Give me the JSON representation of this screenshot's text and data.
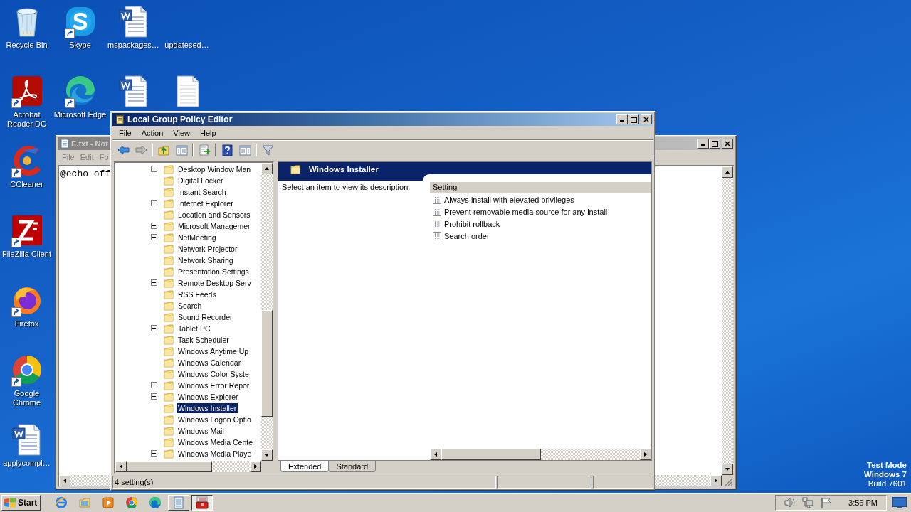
{
  "desktop": {
    "columns": [
      [
        {
          "label": "Recycle Bin",
          "kind": "recycle",
          "shortcut": false
        },
        {
          "label": "Acrobat Reader DC",
          "kind": "acrobat",
          "shortcut": true
        },
        {
          "label": "CCleaner",
          "kind": "ccleaner",
          "shortcut": true
        },
        {
          "label": "FileZilla Client",
          "kind": "filezilla",
          "shortcut": true
        },
        {
          "label": "Firefox",
          "kind": "firefox",
          "shortcut": true
        },
        {
          "label": "Google Chrome",
          "kind": "chrome",
          "shortcut": true
        },
        {
          "label": "applycompl…",
          "kind": "word",
          "shortcut": false
        }
      ],
      [
        {
          "label": "Skype",
          "kind": "skype",
          "shortcut": true
        },
        {
          "label": "Microsoft Edge",
          "kind": "edge",
          "shortcut": true
        }
      ],
      [
        {
          "label": "mspackages…",
          "kind": "word",
          "shortcut": false
        },
        {
          "kind": "word",
          "shortcut": false
        }
      ],
      [
        {
          "label": "updatesed…",
          "kind": "empty",
          "shortcut": false
        },
        {
          "kind": "text",
          "shortcut": false
        }
      ]
    ],
    "edition": [
      "Test Mode",
      "Windows 7",
      "Build 7601"
    ]
  },
  "notepad": {
    "title": "E.txt - Not",
    "menu": [
      "File",
      "Edit",
      "Fo"
    ],
    "text": "@echo off"
  },
  "gpedit": {
    "title": "Local Group Policy Editor",
    "menu": [
      "File",
      "Action",
      "View",
      "Help"
    ],
    "toolbar": [
      {
        "kind": "back"
      },
      {
        "kind": "forward"
      },
      {
        "kind": "separator"
      },
      {
        "kind": "up"
      },
      {
        "kind": "tree"
      },
      {
        "kind": "separator"
      },
      {
        "kind": "export"
      },
      {
        "kind": "separator"
      },
      {
        "kind": "help"
      },
      {
        "kind": "view"
      },
      {
        "kind": "separator"
      },
      {
        "kind": "filter"
      }
    ],
    "tree": [
      {
        "label": "Desktop Window Man",
        "expandable": true,
        "selected": false
      },
      {
        "label": "Digital Locker",
        "expandable": false,
        "selected": false
      },
      {
        "label": "Instant Search",
        "expandable": false,
        "selected": false
      },
      {
        "label": "Internet Explorer",
        "expandable": true,
        "selected": false
      },
      {
        "label": "Location and Sensors",
        "expandable": false,
        "selected": false
      },
      {
        "label": "Microsoft Managemer",
        "expandable": true,
        "selected": false
      },
      {
        "label": "NetMeeting",
        "expandable": true,
        "selected": false
      },
      {
        "label": "Network Projector",
        "expandable": false,
        "selected": false
      },
      {
        "label": "Network Sharing",
        "expandable": false,
        "selected": false
      },
      {
        "label": "Presentation Settings",
        "expandable": false,
        "selected": false
      },
      {
        "label": "Remote Desktop Serv",
        "expandable": true,
        "selected": false
      },
      {
        "label": "RSS Feeds",
        "expandable": false,
        "selected": false
      },
      {
        "label": "Search",
        "expandable": false,
        "selected": false
      },
      {
        "label": "Sound Recorder",
        "expandable": false,
        "selected": false
      },
      {
        "label": "Tablet PC",
        "expandable": true,
        "selected": false
      },
      {
        "label": "Task Scheduler",
        "expandable": false,
        "selected": false
      },
      {
        "label": "Windows Anytime Up",
        "expandable": false,
        "selected": false
      },
      {
        "label": "Windows Calendar",
        "expandable": false,
        "selected": false
      },
      {
        "label": "Windows Color Syste",
        "expandable": false,
        "selected": false
      },
      {
        "label": "Windows Error Repor",
        "expandable": true,
        "selected": false
      },
      {
        "label": "Windows Explorer",
        "expandable": true,
        "selected": false
      },
      {
        "label": "Windows Installer",
        "expandable": false,
        "selected": true
      },
      {
        "label": "Windows Logon Optio",
        "expandable": false,
        "selected": false
      },
      {
        "label": "Windows Mail",
        "expandable": false,
        "selected": false
      },
      {
        "label": "Windows Media Cente",
        "expandable": false,
        "selected": false
      },
      {
        "label": "Windows Media Playe",
        "expandable": true,
        "selected": false
      }
    ],
    "header": "Windows Installer",
    "description": "Select an item to view its description.",
    "column": "Setting",
    "settings": [
      "Always install with elevated privileges",
      "Prevent removable media source for any install",
      "Prohibit rollback",
      "Search order"
    ],
    "tabs": [
      {
        "label": "Extended",
        "selected": true
      },
      {
        "label": "Standard",
        "selected": false
      }
    ],
    "status": "4 setting(s)"
  },
  "taskbar": {
    "start": "Start",
    "apps": [
      {
        "kind": "ie",
        "window": false
      },
      {
        "kind": "explorer",
        "window": false
      },
      {
        "kind": "media",
        "window": false
      },
      {
        "kind": "chrome",
        "window": false
      },
      {
        "kind": "edge",
        "window": false
      },
      {
        "kind": "notepad",
        "window": true,
        "selected": false
      },
      {
        "kind": "gpedit",
        "window": true,
        "selected": true
      }
    ],
    "tray": [
      {
        "kind": "speaker"
      },
      {
        "kind": "network"
      },
      {
        "kind": "flag"
      }
    ],
    "clock": "3:56 PM"
  }
}
